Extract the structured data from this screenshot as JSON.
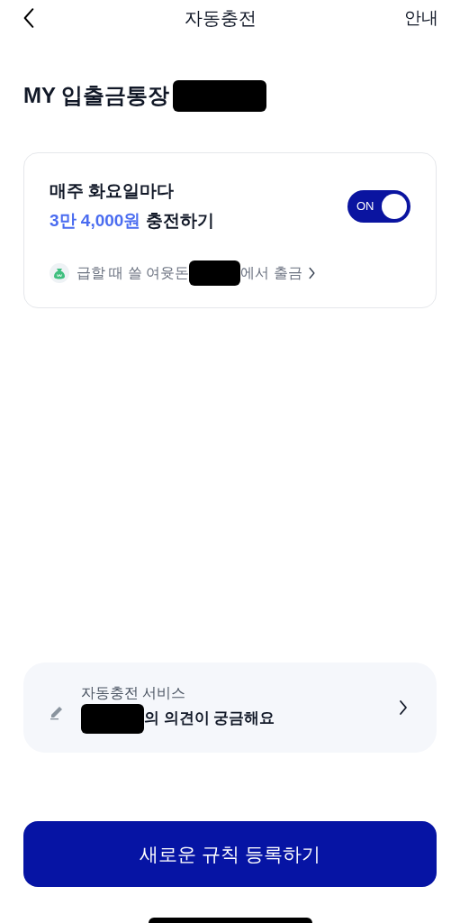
{
  "header": {
    "title": "자동충전",
    "info_link": "안내"
  },
  "account": {
    "name": "MY 입출금통장",
    "redacted": true
  },
  "rule_card": {
    "schedule": "매주 화요일마다",
    "amount": "3만 4,000원",
    "action": "충전하기",
    "toggle": {
      "label": "ON",
      "on": true
    },
    "source_prefix": "급할 때 쓸 여윳돈",
    "source_redacted": true,
    "source_suffix": "에서 출금"
  },
  "feedback_card": {
    "subtitle": "자동충전 서비스",
    "redacted": true,
    "title": "의 의견이 궁금해요"
  },
  "primary_button": "새로운 규칙 등록하기"
}
